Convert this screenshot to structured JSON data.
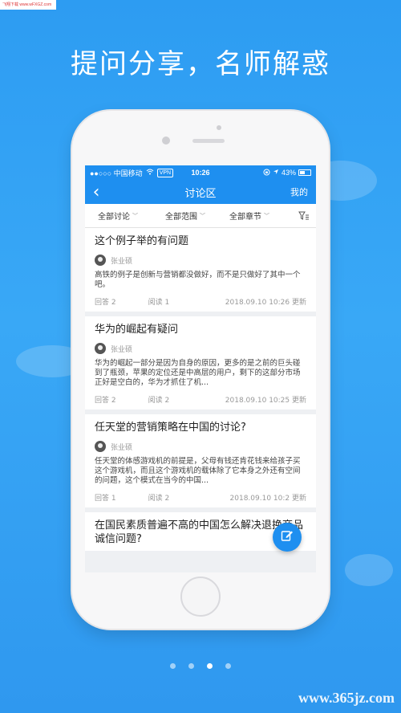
{
  "corner_tag": "飞翔下载 www.wFXGZ.com",
  "headline": "提问分享，名师解惑",
  "statusbar": {
    "carrier": "●●○○○ 中国移动",
    "vpn": "VPN",
    "time": "10:26",
    "battery": "43%"
  },
  "navbar": {
    "back_icon": "‹",
    "title": "讨论区",
    "mine": "我的"
  },
  "filters": {
    "all_discussions": "全部讨论",
    "all_scope": "全部范围",
    "all_chapters": "全部章节"
  },
  "posts": [
    {
      "title": "这个例子举的有问题",
      "author": "张业硕",
      "excerpt": "高铁的例子是创新与营销都没做好，而不是只做好了其中一个吧。",
      "answers": "回答 2",
      "reads": "阅读 1",
      "time": "2018.09.10 10:26 更新"
    },
    {
      "title": "华为的崛起有疑问",
      "author": "张业硕",
      "excerpt": "华为的崛起一部分是因为自身的原因，更多的是之前的巨头碰到了瓶颈，苹果的定位还是中高层的用户，剩下的这部分市场正好是空白的，华为才抓住了机...",
      "answers": "回答 2",
      "reads": "阅读 2",
      "time": "2018.09.10 10:25 更新"
    },
    {
      "title": "任天堂的营销策略在中国的讨论?",
      "author": "张业硕",
      "excerpt": "任天堂的体感游戏机的前提是，父母有钱还肯花钱来给孩子买这个游戏机，而且这个游戏机的载体除了它本身之外还有空间的问题，这个模式在当今的中国...",
      "answers": "回答 1",
      "reads": "阅读 2",
      "time": "2018.09.10 10:2 更新"
    },
    {
      "title": "在国民素质普遍不高的中国怎么解决退换商品诚信问题?",
      "author": "",
      "excerpt": "",
      "answers": "",
      "reads": "",
      "time": ""
    }
  ],
  "pagination": {
    "count": 4,
    "active_index": 2
  },
  "watermark": "www.365jz.com",
  "colors": {
    "accent": "#1e8ff0",
    "background": "#2d9cf2"
  }
}
